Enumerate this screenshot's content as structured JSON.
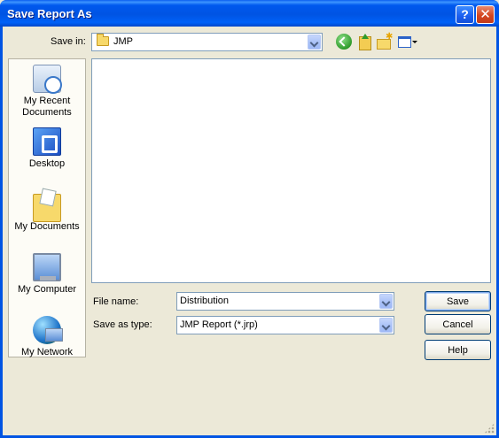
{
  "window": {
    "title": "Save Report As"
  },
  "titlebar_buttons": {
    "help": "?",
    "close": "✕"
  },
  "toolbar": {
    "save_in_label": "Save in:",
    "save_in_value": "JMP",
    "icons": [
      "back-icon",
      "up-one-level-icon",
      "new-folder-icon",
      "views-menu-icon"
    ]
  },
  "places": [
    {
      "label": "My Recent Documents",
      "icon": "recent-documents-icon"
    },
    {
      "label": "Desktop",
      "icon": "desktop-icon"
    },
    {
      "label": "My Documents",
      "icon": "my-documents-icon"
    },
    {
      "label": "My Computer",
      "icon": "my-computer-icon"
    },
    {
      "label": "My Network",
      "icon": "my-network-icon"
    }
  ],
  "form": {
    "file_name_label": "File name:",
    "file_name_value": "Distribution",
    "save_as_type_label": "Save as type:",
    "save_as_type_value": "JMP Report (*.jrp)"
  },
  "buttons": {
    "save": "Save",
    "cancel": "Cancel",
    "help": "Help"
  },
  "colors": {
    "titlebar": "#0054e3",
    "face": "#ece9d8",
    "field_border": "#7f9db9"
  }
}
